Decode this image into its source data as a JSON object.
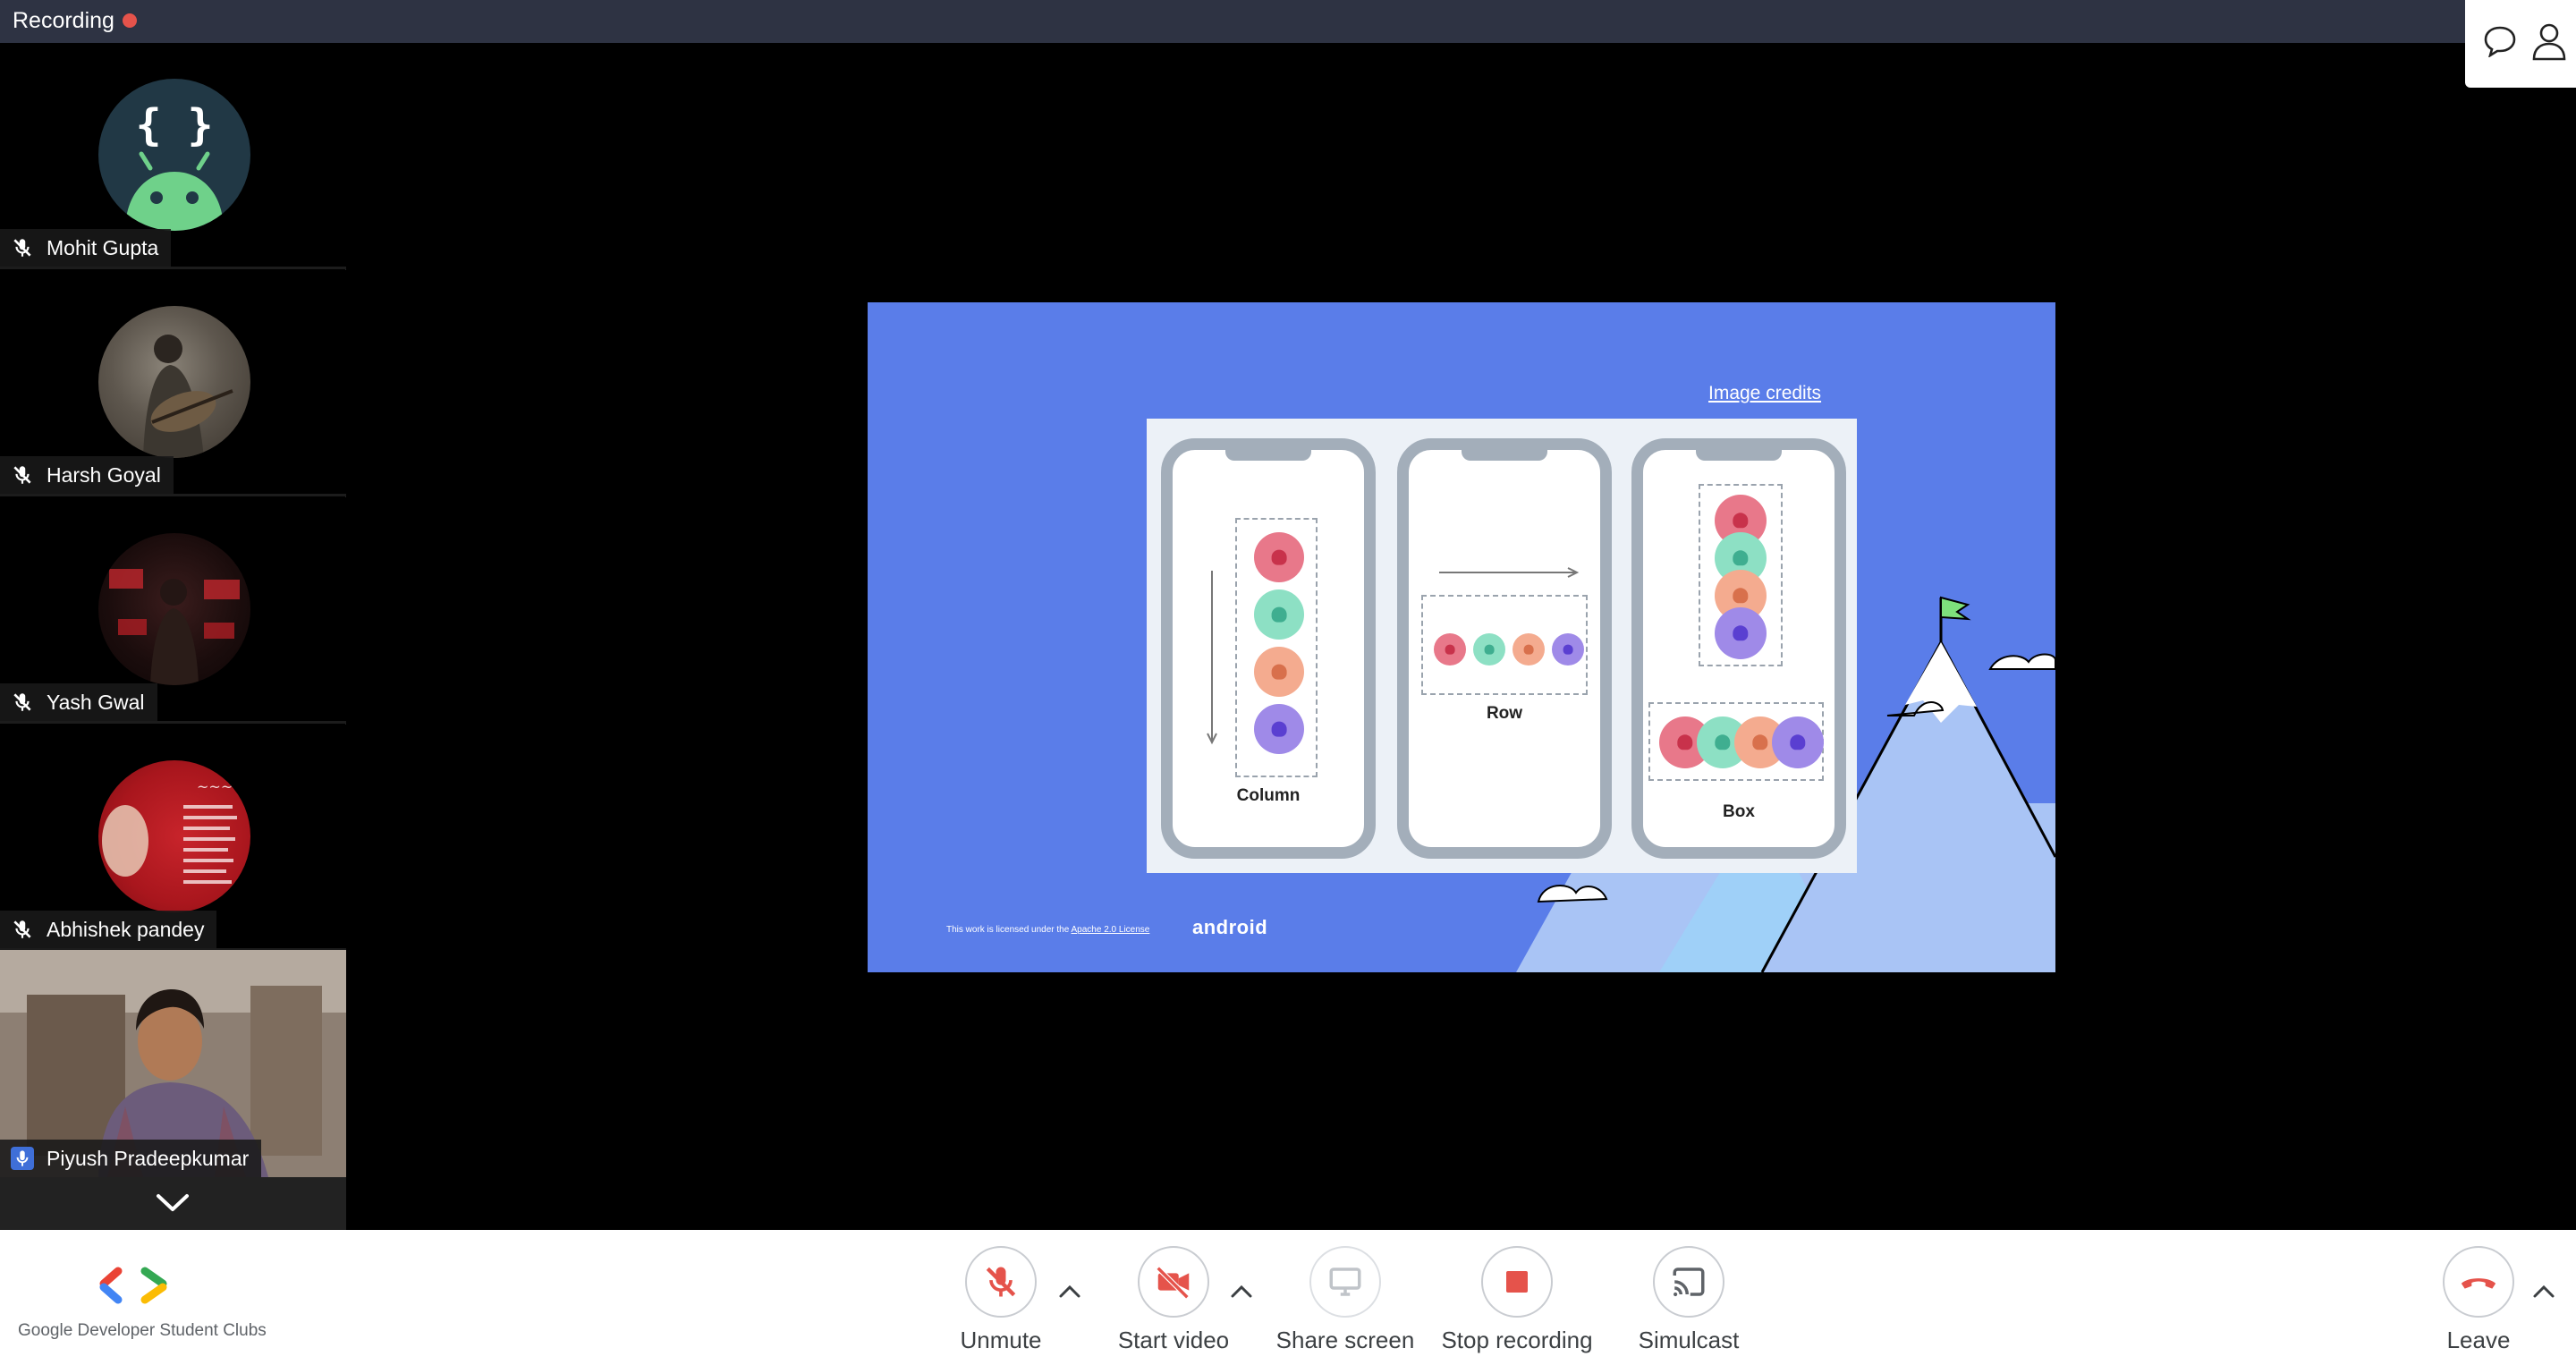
{
  "topbar": {
    "recording_label": "Recording",
    "recording_color": "#e5534b"
  },
  "top_actions": [
    {
      "icon": "chat-icon"
    },
    {
      "icon": "participants-icon"
    }
  ],
  "participants": [
    {
      "name": "Mohit Gupta",
      "muted": true,
      "avatar": "android-logo"
    },
    {
      "name": "Harsh Goyal",
      "muted": true,
      "avatar": "photo"
    },
    {
      "name": "Yash Gwal",
      "muted": true,
      "avatar": "photo"
    },
    {
      "name": "Abhishek pandey",
      "muted": true,
      "avatar": "photo"
    },
    {
      "name": "Piyush Pradeepkumar",
      "muted": false,
      "avatar": "video"
    }
  ],
  "slide": {
    "credits": "Image credits",
    "license_prefix": "This work is licensed under the ",
    "license_link": "Apache 2.0 License",
    "brand": "android",
    "phones": [
      {
        "caption": "Column"
      },
      {
        "caption": "Row"
      },
      {
        "caption": "Box"
      }
    ]
  },
  "bottombar": {
    "brand_text": "Google Developer Student Clubs",
    "controls": [
      {
        "label": "Unmute",
        "icon": "mic-off-icon",
        "color": "#e5534b"
      },
      {
        "label": "Start video",
        "icon": "video-off-icon",
        "color": "#e5534b"
      },
      {
        "label": "Share screen",
        "icon": "screen-share-icon",
        "color": "#c0c4c9"
      },
      {
        "label": "Stop recording",
        "icon": "stop-icon",
        "color": "#e5534b"
      },
      {
        "label": "Simulcast",
        "icon": "cast-icon",
        "color": "#5f6368"
      },
      {
        "label": "Leave",
        "icon": "hang-up-icon",
        "color": "#e5534b"
      }
    ]
  }
}
